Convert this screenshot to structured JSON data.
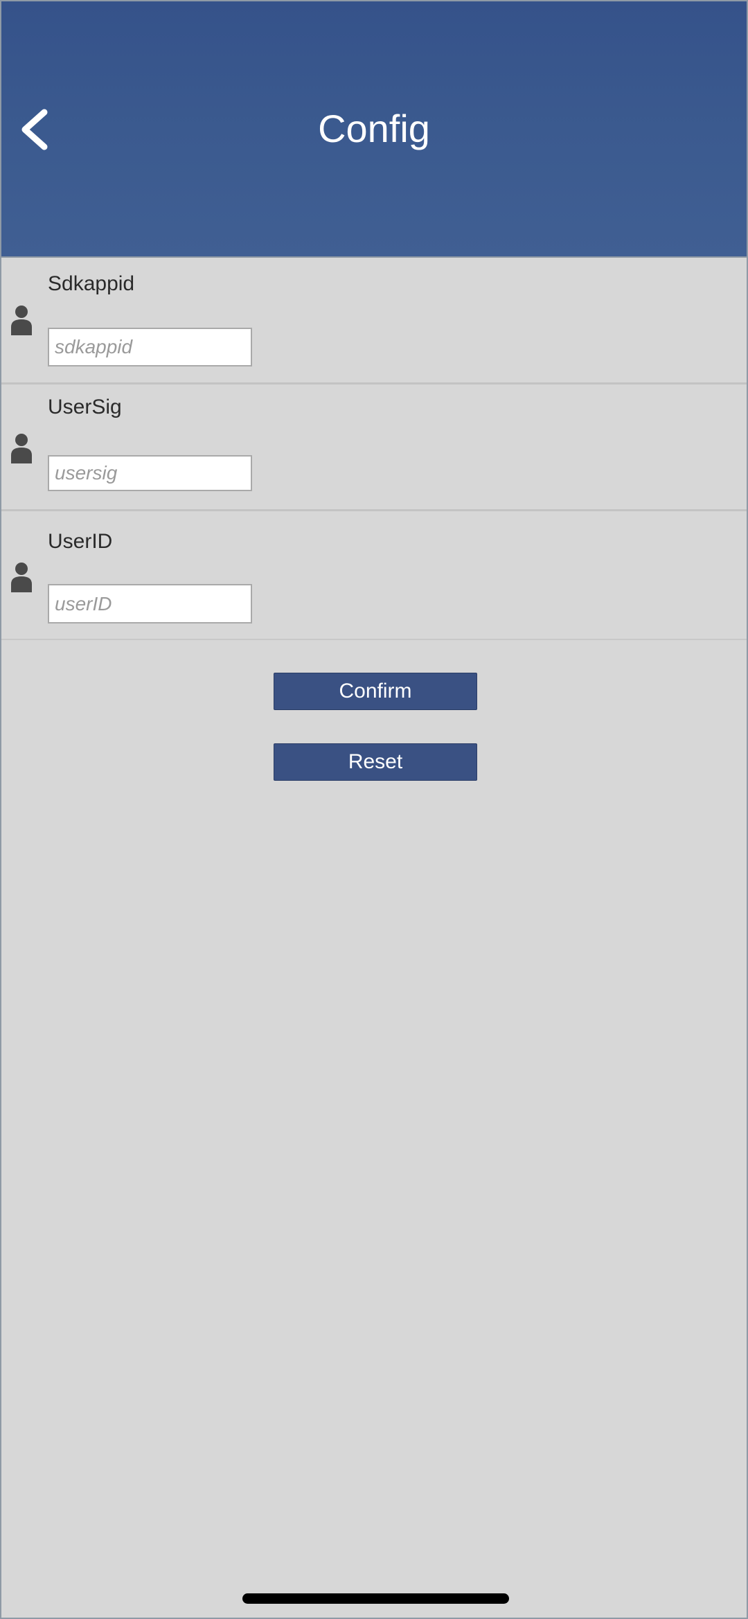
{
  "header": {
    "title": "Config",
    "back_icon": "chevron-left-icon",
    "background_color": "#3b5a8f"
  },
  "fields": [
    {
      "label": "Sdkappid",
      "placeholder": "sdkappid",
      "value": "",
      "icon": "user-icon"
    },
    {
      "label": "UserSig",
      "placeholder": "usersig",
      "value": "",
      "icon": "user-icon"
    },
    {
      "label": "UserID",
      "placeholder": "userID",
      "value": "",
      "icon": "user-icon"
    }
  ],
  "actions": {
    "confirm_label": "Confirm",
    "reset_label": "Reset",
    "button_color": "#3a5183"
  },
  "colors": {
    "page_background": "#d7d7d7",
    "icon_color": "#4a4a4a"
  }
}
